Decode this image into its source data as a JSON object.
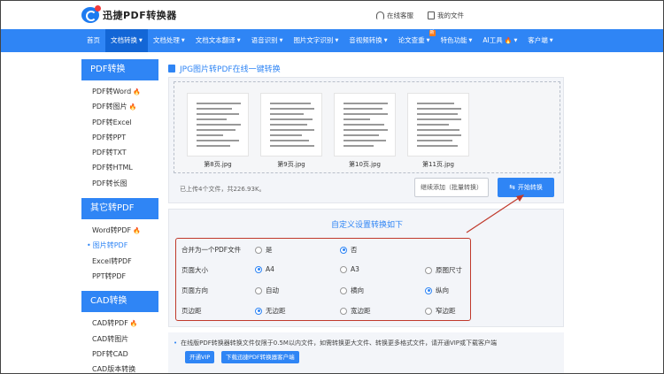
{
  "header": {
    "logo_text": "迅捷PDF转换器",
    "online_service": "在线客服",
    "my_files": "我的文件"
  },
  "nav": {
    "items": [
      {
        "label": "首页"
      },
      {
        "label": "文档转换",
        "caret": "▼"
      },
      {
        "label": "文档处理",
        "caret": "▼"
      },
      {
        "label": "文档文本翻译",
        "caret": "▼"
      },
      {
        "label": "语音识别",
        "caret": "▼"
      },
      {
        "label": "图片文字识别",
        "caret": "▼"
      },
      {
        "label": "音视频转换",
        "caret": "▼"
      },
      {
        "label": "论文查重",
        "caret": "▼",
        "badge": "新"
      },
      {
        "label": "特色功能",
        "caret": "▼"
      },
      {
        "label": "AI工具",
        "caret": "▼"
      },
      {
        "label": "客户端",
        "caret": "▼"
      }
    ]
  },
  "sidebar": {
    "sections": [
      {
        "title": "PDF转换",
        "items": [
          "PDF转Word",
          "PDF转图片",
          "PDF转Excel",
          "PDF转PPT",
          "PDF转TXT",
          "PDF转HTML",
          "PDF转长图"
        ]
      },
      {
        "title": "其它转PDF",
        "items": [
          "Word转PDF",
          "图片转PDF",
          "Excel转PDF",
          "PPT转PDF"
        ]
      },
      {
        "title": "CAD转换",
        "items": [
          "CAD转PDF",
          "CAD转图片",
          "PDF转CAD",
          "CAD版本转换"
        ]
      }
    ]
  },
  "main": {
    "title": "JPG图片转PDF在线一键转换",
    "thumbnails": [
      "第8页.jpg",
      "第9页.jpg",
      "第10页.jpg",
      "第11页.jpg"
    ],
    "upload_info": "已上传4个文件，共226.93K。",
    "add_button": "继续添加（批量转换）",
    "start_button": "开始转换"
  },
  "settings": {
    "title": "自定义设置转换如下",
    "rows": [
      {
        "label": "合并为一个PDF文件",
        "options": [
          "是",
          "否"
        ],
        "selected": 1
      },
      {
        "label": "页面大小",
        "options": [
          "A4",
          "A3",
          "原图尺寸"
        ],
        "selected": 0
      },
      {
        "label": "页面方向",
        "options": [
          "自动",
          "横向",
          "纵向"
        ],
        "selected": 2
      },
      {
        "label": "页边距",
        "options": [
          "无边距",
          "宽边距",
          "窄边距"
        ],
        "selected": 0
      }
    ]
  },
  "notice": {
    "text": "在线版PDF转换器转换文件仅限于0.5M以内文件，如需转换更大文件、转换更多格式文件，请开通VIP或下载客户端",
    "vip_button": "开通VIP",
    "download_button": "下载迅捷PDF转换器客户端"
  },
  "colors": {
    "primary": "#2f85f5",
    "active_nav": "#1366d6",
    "highlight": "#c0392b",
    "fire": "#ff5a1f"
  },
  "icons": {
    "sidebar_fire": "fire-icon",
    "start": "swap-icon"
  }
}
